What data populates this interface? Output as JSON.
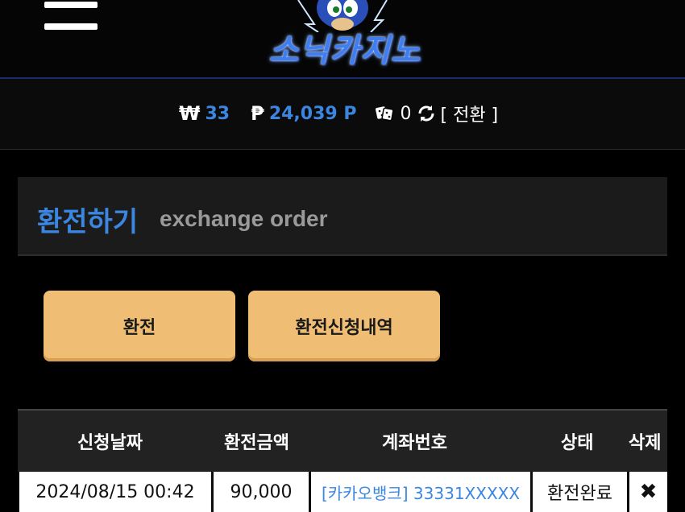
{
  "header": {
    "menu_icon": "hamburger-icon",
    "logo_text": "소닉카지노"
  },
  "balance": {
    "won_symbol": "₩",
    "won_value": "33",
    "point_symbol": "₱",
    "point_value": "24,039 P",
    "dice_icon": "dice-icon",
    "dice_value": "0",
    "refresh_icon": "refresh-icon",
    "convert_label": "[ 전환 ]"
  },
  "panel": {
    "title": "환전하기",
    "subtitle": "exchange order"
  },
  "buttons": {
    "exchange_label": "환전",
    "history_label": "환전신청내역"
  },
  "table": {
    "headers": [
      "신청날짜",
      "환전금액",
      "계좌번호",
      "상태",
      "삭제"
    ],
    "rows": [
      {
        "date": "2024/08/15 00:42",
        "amount": "90,000",
        "account": "[카카오뱅크] 33331XXXXX",
        "status": "환전완료",
        "delete_icon": "✖"
      }
    ]
  },
  "colors": {
    "accent_blue": "#3a86e0",
    "button_gold": "#efbd74",
    "background": "#000000"
  }
}
